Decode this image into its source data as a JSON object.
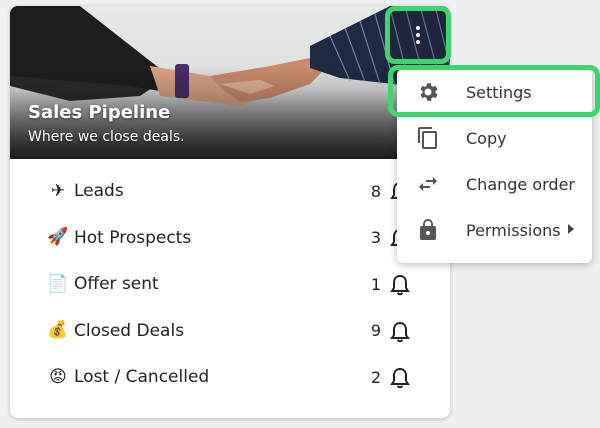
{
  "pipeline": {
    "title": "Sales Pipeline",
    "subtitle": "Where we close deals.",
    "stages": [
      {
        "emoji": "✈",
        "icon": "airplane-icon",
        "label": "Leads",
        "count": "8"
      },
      {
        "emoji": "🚀",
        "icon": "rocket-icon",
        "label": "Hot Prospects",
        "count": "3"
      },
      {
        "emoji": "📄",
        "icon": "document-icon",
        "label": "Offer sent",
        "count": "1"
      },
      {
        "emoji": "💰",
        "icon": "money-bag-icon",
        "label": "Closed Deals",
        "count": "9"
      },
      {
        "emoji": "😡",
        "icon": "angry-face-icon",
        "label": "Lost / Cancelled",
        "count": "2"
      }
    ]
  },
  "menu": {
    "items": [
      {
        "label": "Settings",
        "icon": "gear-icon"
      },
      {
        "label": "Copy",
        "icon": "copy-icon"
      },
      {
        "label": "Change order",
        "icon": "swap-arrows-icon"
      },
      {
        "label": "Permissions",
        "icon": "lock-icon",
        "has_submenu": true
      }
    ]
  },
  "colors": {
    "highlight": "#3ed56c",
    "icon_gray": "#555555",
    "text": "#222222"
  }
}
